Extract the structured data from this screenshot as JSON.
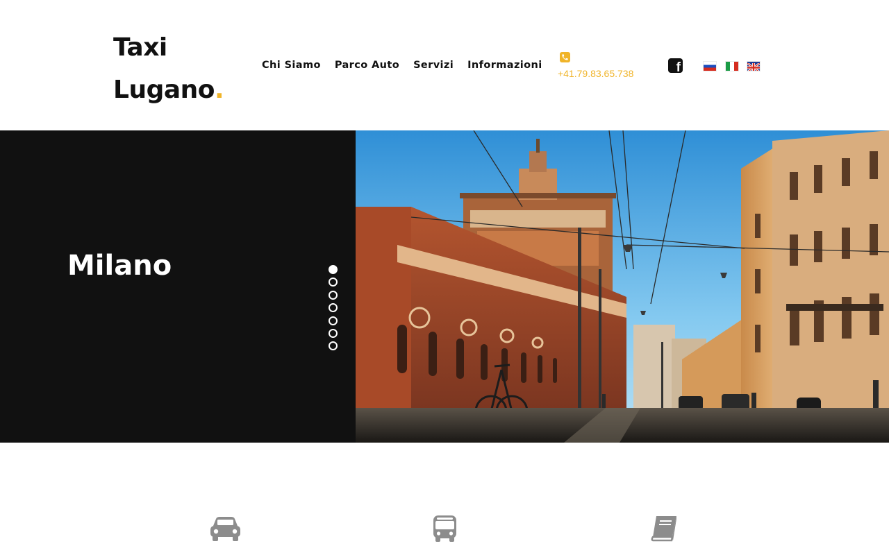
{
  "header": {
    "logo_line1": "Taxi",
    "logo_line2": "Lugano",
    "logo_dot": ".",
    "nav": [
      "Chi Siamo",
      "Parco Auto",
      "Servizi",
      "Informazioni"
    ],
    "phone": "+41.79.83.65.738",
    "languages": [
      "ru",
      "it",
      "en"
    ]
  },
  "hero": {
    "title": "Milano",
    "slides_count": 7,
    "active_slide": 1
  },
  "services": {
    "icons": [
      "car-icon",
      "bus-icon",
      "book-icon"
    ]
  },
  "colors": {
    "accent": "#f0b429",
    "dark": "#111111",
    "icon_gray": "#8c8c8c"
  }
}
